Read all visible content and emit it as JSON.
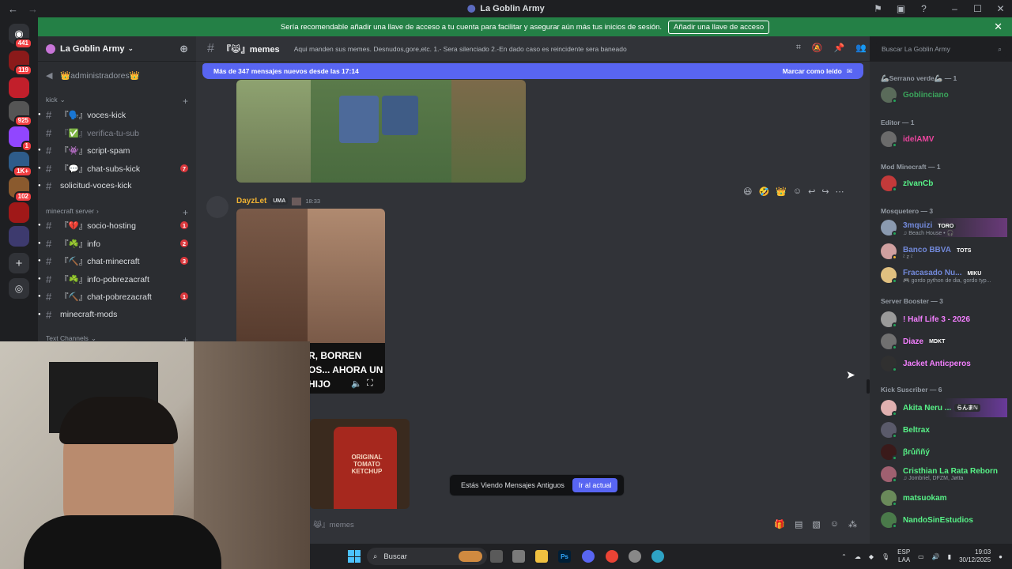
{
  "window": {
    "title": "La Goblin Army",
    "back": "←",
    "forward": "→"
  },
  "guild_badges": [
    "441",
    "119",
    "925",
    "1",
    "1K+",
    "102"
  ],
  "banner": {
    "text": "Sería recomendable añadir una llave de acceso a tu cuenta para facilitar y asegurar aún más tus inicios de sesión.",
    "button": "Añadir una llave de acceso"
  },
  "server": {
    "name": "La Goblin Army"
  },
  "sidebar": {
    "top_item": "👑administradores👑",
    "categories": [
      "kick",
      "minecraft server",
      "Text Channels"
    ],
    "channels": [
      {
        "name": "『🗣️』voces-kick",
        "badge": ""
      },
      {
        "name": "『✅』verifica-tu-sub",
        "badge": ""
      },
      {
        "name": "『👾』script-spam",
        "badge": ""
      },
      {
        "name": "『💬』chat-subs-kick",
        "badge": "7"
      },
      {
        "name": "solicitud-voces-kick",
        "badge": ""
      },
      {
        "name": "『💔』socio-hosting",
        "badge": "1"
      },
      {
        "name": "『☘️』info",
        "badge": "2"
      },
      {
        "name": "『⛏️』chat-minecraft",
        "badge": "3"
      },
      {
        "name": "『☘️』info-pobrezacraft",
        "badge": ""
      },
      {
        "name": "『⛏️』chat-pobrezacraft",
        "badge": "1"
      },
      {
        "name": "minecraft-mods",
        "badge": ""
      }
    ]
  },
  "chat": {
    "channel": "『😹』memes",
    "topic": "Aqui manden sus memes. Desnudos,gore,etc. 1.- Sera silenciado 2.-En dado caso es reincidente sera baneado",
    "search_placeholder": "Buscar La Goblin Army",
    "new_messages": "Más de 347 mensajes nuevos desde las 17:14",
    "mark_read": "Marcar como leído",
    "message": {
      "author": "DayzLet",
      "tag": "UMA",
      "time": "18:33",
      "video_text": "R, BORREN OS... AHORA UN HIJO"
    },
    "old_notice": "Estás Viendo Mensajes Antiguos",
    "jump_button": "Ir al actual",
    "composer_placeholder": "😹』memes",
    "ketchup_label": "ORIGINAL TOMATO KETCHUP"
  },
  "members": {
    "roles": [
      "🦾Serrano verde🦾 — 1",
      "Editor — 1",
      "Mod Minecraft — 1",
      "Mosquetero — 3",
      "Server Booster — 3",
      "Kick Suscriber — 6"
    ],
    "list": [
      {
        "name": "Goblinciano",
        "color": "#3ba55c",
        "sub": "",
        "tag": ""
      },
      {
        "name": "idelAMV",
        "color": "#eb459e",
        "sub": "",
        "tag": ""
      },
      {
        "name": "zIvanCb",
        "color": "#57f287",
        "sub": "",
        "tag": ""
      },
      {
        "name": "3mquizi",
        "color": "#5865f2",
        "sub": "♫ Beach House • 🎧",
        "tag": "TORO"
      },
      {
        "name": "Banco BBVA",
        "color": "#5865f2",
        "sub": "ᶻ z ᶻ",
        "tag": "TOTS"
      },
      {
        "name": "Fracasado Nu...",
        "color": "#5865f2",
        "sub": "🎮 gordo python de dia, gordo typ...",
        "tag": "MIKU"
      },
      {
        "name": "! Half Life 3 - 2026",
        "color": "#f47fff",
        "sub": "",
        "tag": ""
      },
      {
        "name": "Diaze",
        "color": "#f47fff",
        "sub": "",
        "tag": "MDKT"
      },
      {
        "name": "Jacket Anticperos",
        "color": "#f47fff",
        "sub": "",
        "tag": ""
      },
      {
        "name": "Akita Neru ...",
        "color": "#57f287",
        "sub": "",
        "tag": "らんまℕ"
      },
      {
        "name": "Beltrax",
        "color": "#57f287",
        "sub": "",
        "tag": ""
      },
      {
        "name": "βrůññý",
        "color": "#57f287",
        "sub": "",
        "tag": ""
      },
      {
        "name": "Cristhian La Rata Reborn",
        "color": "#57f287",
        "sub": "♫ Jombriel, DFZM, Jøtta",
        "tag": ""
      },
      {
        "name": "matsuokam",
        "color": "#57f287",
        "sub": "",
        "tag": ""
      },
      {
        "name": "NandoSinEstudios",
        "color": "#57f287",
        "sub": "",
        "tag": ""
      }
    ]
  },
  "taskbar": {
    "search": "Buscar",
    "lang": "ESP",
    "layout": "LAA",
    "time": "19:03",
    "date": "30/12/2025"
  }
}
